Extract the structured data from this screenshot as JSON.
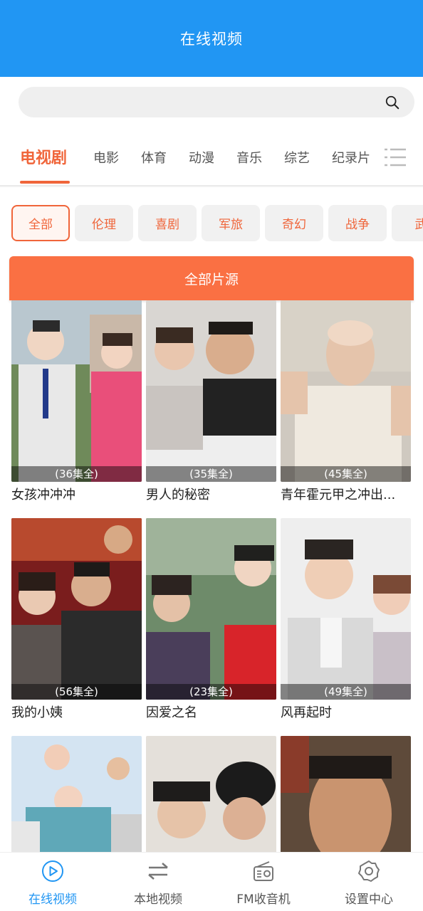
{
  "header": {
    "title": "在线视频"
  },
  "search": {
    "placeholder": "",
    "icon": "search-icon"
  },
  "tabs": [
    {
      "label": "电视剧",
      "active": true
    },
    {
      "label": "电影"
    },
    {
      "label": "体育"
    },
    {
      "label": "动漫"
    },
    {
      "label": "音乐"
    },
    {
      "label": "综艺"
    },
    {
      "label": "纪录片"
    }
  ],
  "tabs_menu_icon": "list-menu-icon",
  "genres": [
    {
      "label": "全部",
      "active": true
    },
    {
      "label": "伦理"
    },
    {
      "label": "喜剧"
    },
    {
      "label": "军旅"
    },
    {
      "label": "奇幻"
    },
    {
      "label": "战争"
    },
    {
      "label": "武"
    }
  ],
  "source_bar": {
    "label": "全部片源"
  },
  "videos": [
    {
      "title": "女孩冲冲冲",
      "episodes": "(36集全)"
    },
    {
      "title": "男人的秘密",
      "episodes": "(35集全)"
    },
    {
      "title": "青年霍元甲之冲出...",
      "episodes": "(45集全)"
    },
    {
      "title": "我的小姨",
      "episodes": "(56集全)"
    },
    {
      "title": "因爱之名",
      "episodes": "(23集全)"
    },
    {
      "title": "风再起时",
      "episodes": "(49集全)"
    },
    {
      "title": "",
      "episodes": ""
    },
    {
      "title": "",
      "episodes": ""
    },
    {
      "title": "",
      "episodes": ""
    }
  ],
  "bottom_nav": [
    {
      "label": "在线视频",
      "icon": "play-circle-icon",
      "active": true
    },
    {
      "label": "本地视频",
      "icon": "transfer-arrows-icon"
    },
    {
      "label": "FM收音机",
      "icon": "radio-icon"
    },
    {
      "label": "设置中心",
      "icon": "settings-gear-icon"
    }
  ],
  "colors": {
    "header_bg": "#2196f3",
    "accent": "#f0653a",
    "source_bar_bg": "#fa7043"
  }
}
